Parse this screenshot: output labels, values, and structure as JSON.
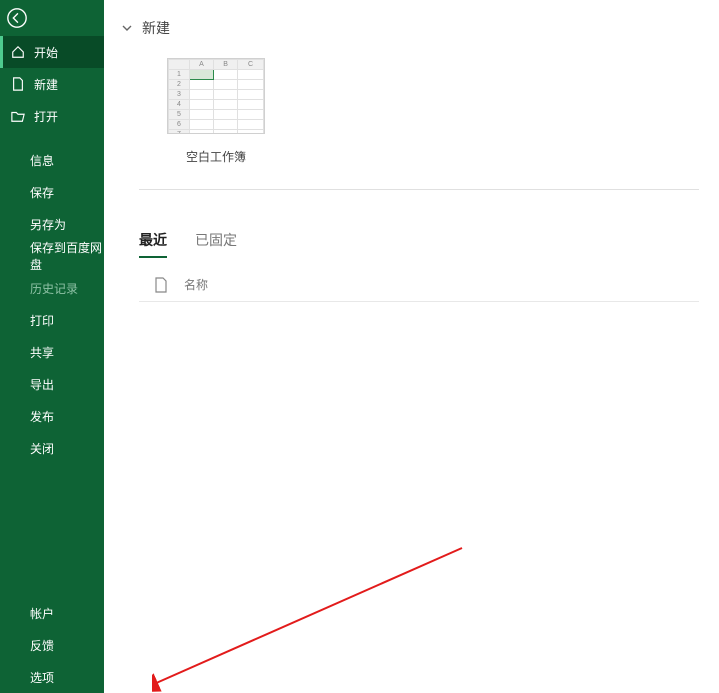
{
  "sidebar": {
    "top": [
      {
        "label": "开始",
        "icon": "home"
      },
      {
        "label": "新建",
        "icon": "file"
      },
      {
        "label": "打开",
        "icon": "folder-open"
      }
    ],
    "middle": [
      {
        "label": "信息"
      },
      {
        "label": "保存"
      },
      {
        "label": "另存为"
      },
      {
        "label": "保存到百度网盘"
      },
      {
        "label": "历史记录",
        "disabled": true
      },
      {
        "label": "打印"
      },
      {
        "label": "共享"
      },
      {
        "label": "导出"
      },
      {
        "label": "发布"
      },
      {
        "label": "关闭"
      }
    ],
    "bottom": [
      {
        "label": "帐户"
      },
      {
        "label": "反馈"
      },
      {
        "label": "选项"
      }
    ]
  },
  "main": {
    "sectionTitle": "新建",
    "template": {
      "label": "空白工作簿"
    },
    "tabs": {
      "recent": "最近",
      "pinned": "已固定"
    },
    "listHeader": {
      "name": "名称"
    }
  }
}
